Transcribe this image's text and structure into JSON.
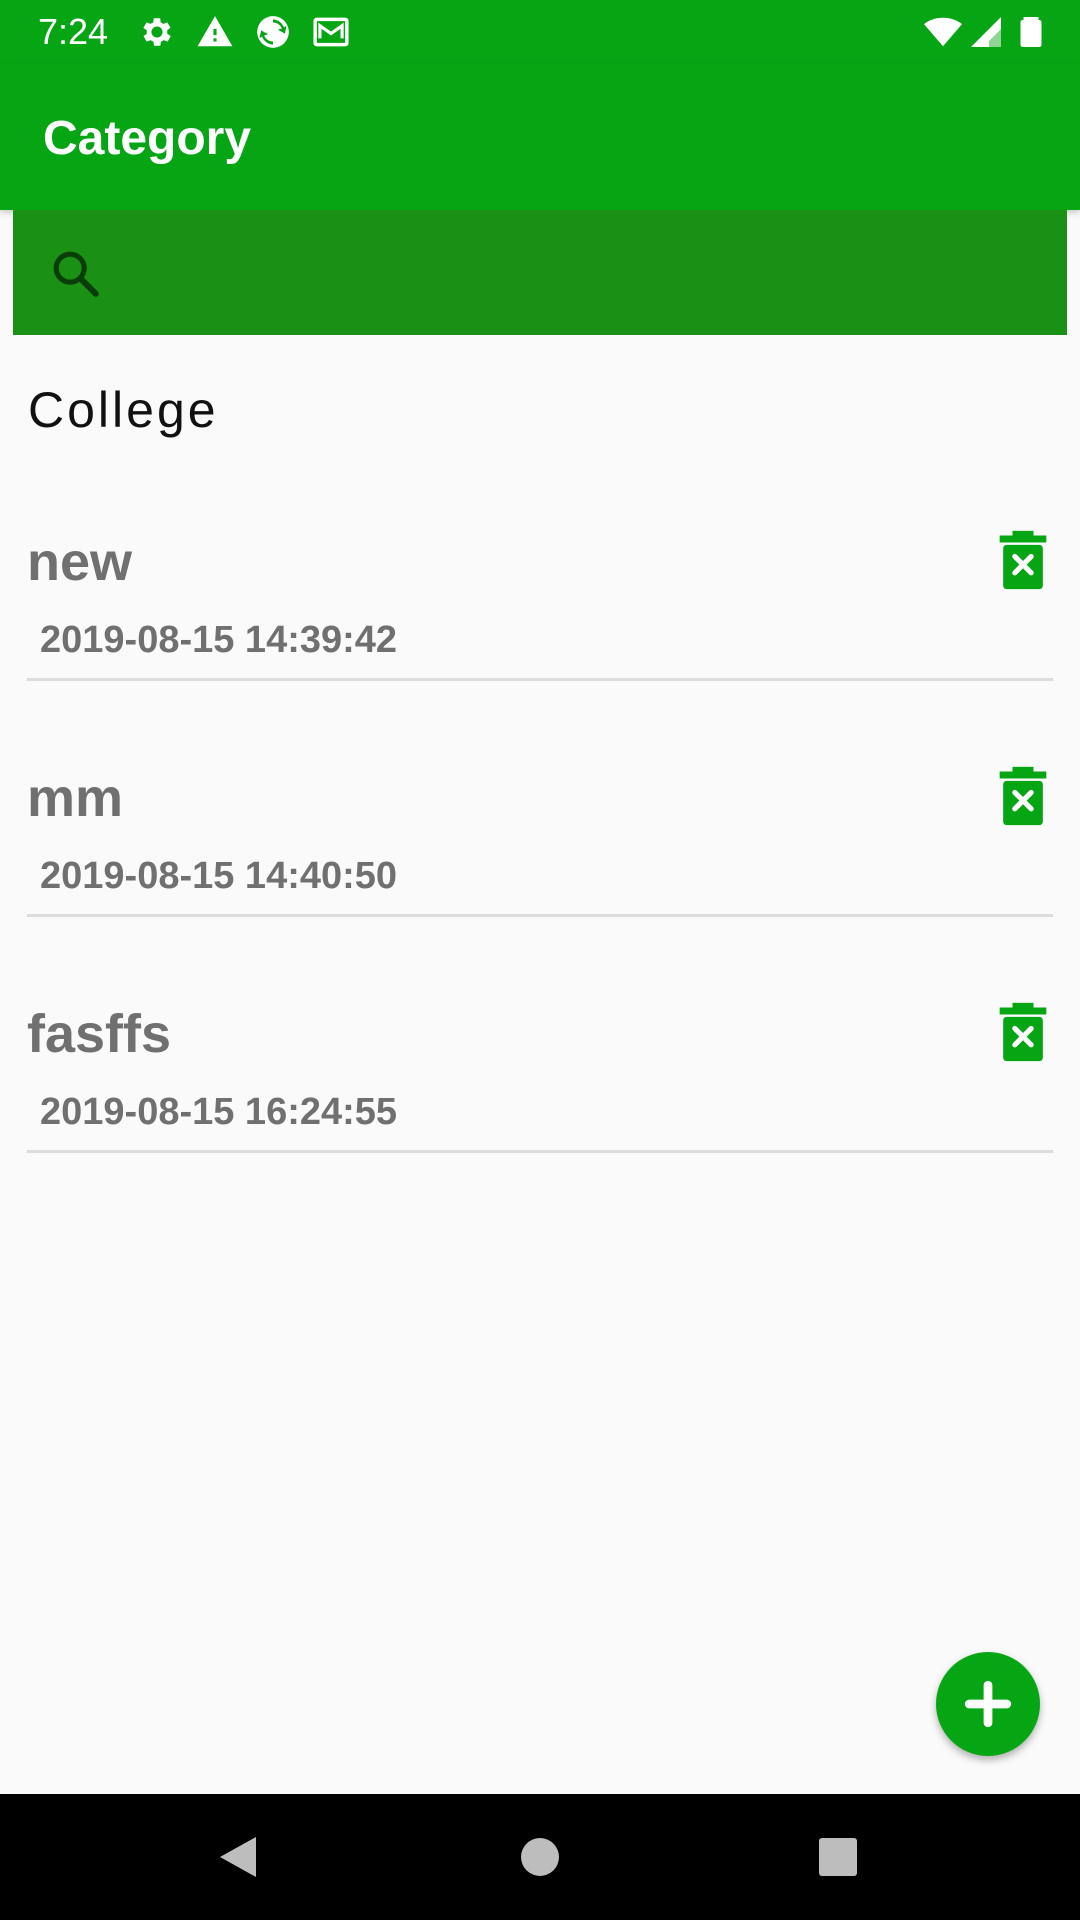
{
  "status_bar": {
    "time": "7:24",
    "left_icons": [
      "settings-icon",
      "alert-icon",
      "sync-icon",
      "mail-icon"
    ],
    "right_icons": [
      "wifi-icon",
      "signal-icon",
      "battery-icon"
    ]
  },
  "app_bar": {
    "title": "Category"
  },
  "search": {
    "placeholder": "",
    "value": "",
    "icon": "search-icon"
  },
  "section": {
    "title": "College"
  },
  "items": [
    {
      "title": "new",
      "date": "2019-08-15 14:39:42"
    },
    {
      "title": "mm",
      "date": "2019-08-15 14:40:50"
    },
    {
      "title": "fasffs",
      "date": "2019-08-15 16:24:55"
    }
  ],
  "fab": {
    "icon": "plus-icon"
  },
  "nav": {
    "icons": [
      "back-icon",
      "home-icon",
      "recents-icon"
    ]
  },
  "colors": {
    "primary": "#06a514",
    "search_bg": "#1a9115",
    "item_text": "#707070",
    "background": "#fafafa"
  }
}
